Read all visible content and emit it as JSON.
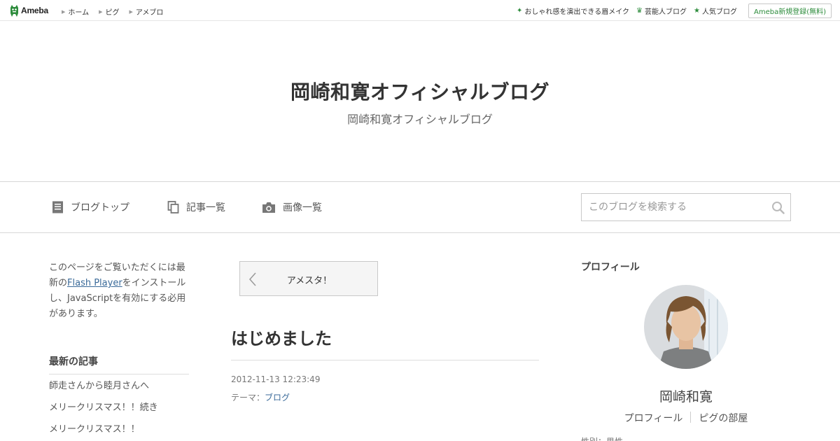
{
  "topbar": {
    "logo_text": "Ameba",
    "nav": [
      {
        "label": "ホーム"
      },
      {
        "label": "ピグ"
      },
      {
        "label": "アメブロ"
      }
    ],
    "right_links": [
      {
        "label": "おしゃれ感を演出できる眉メイク",
        "icon": "sparkle-icon"
      },
      {
        "label": "芸能人ブログ",
        "icon": "crown-icon"
      },
      {
        "label": "人気ブログ",
        "icon": "star-icon"
      }
    ],
    "register_label": "Ameba新規登録(無料)",
    "accent_color": "#2d8c3c"
  },
  "header": {
    "title": "岡崎和寛オフィシャルブログ",
    "description": "岡崎和寛オフィシャルブログ"
  },
  "nav": {
    "items": [
      {
        "label": "ブログトップ",
        "icon": "document-icon"
      },
      {
        "label": "記事一覧",
        "icon": "copy-icon"
      },
      {
        "label": "画像一覧",
        "icon": "camera-icon"
      }
    ],
    "search_placeholder": "このブログを検索する"
  },
  "left": {
    "flash_prefix": "このページをご覧いただくには最新の",
    "flash_link": "Flash Player",
    "flash_suffix": "をインストールし、JavaScriptを有効にする必用があります。",
    "recent_title": "最新の記事",
    "recent_items": [
      {
        "label": "師走さんから睦月さんへ"
      },
      {
        "label": "メリークリスマス！！続き"
      },
      {
        "label": "メリークリスマス！！"
      }
    ]
  },
  "main": {
    "prev_label": "アメスタ！",
    "entry_title": "はじめました",
    "entry_date": "2012-11-13 12:23:49",
    "theme_prefix": "テーマ：",
    "theme_link": "ブログ"
  },
  "profile": {
    "heading": "プロフィール",
    "name": "岡崎和寛",
    "links": [
      {
        "label": "プロフィール"
      },
      {
        "label": "ピグの部屋"
      }
    ],
    "cut_text": "性別：男性"
  }
}
